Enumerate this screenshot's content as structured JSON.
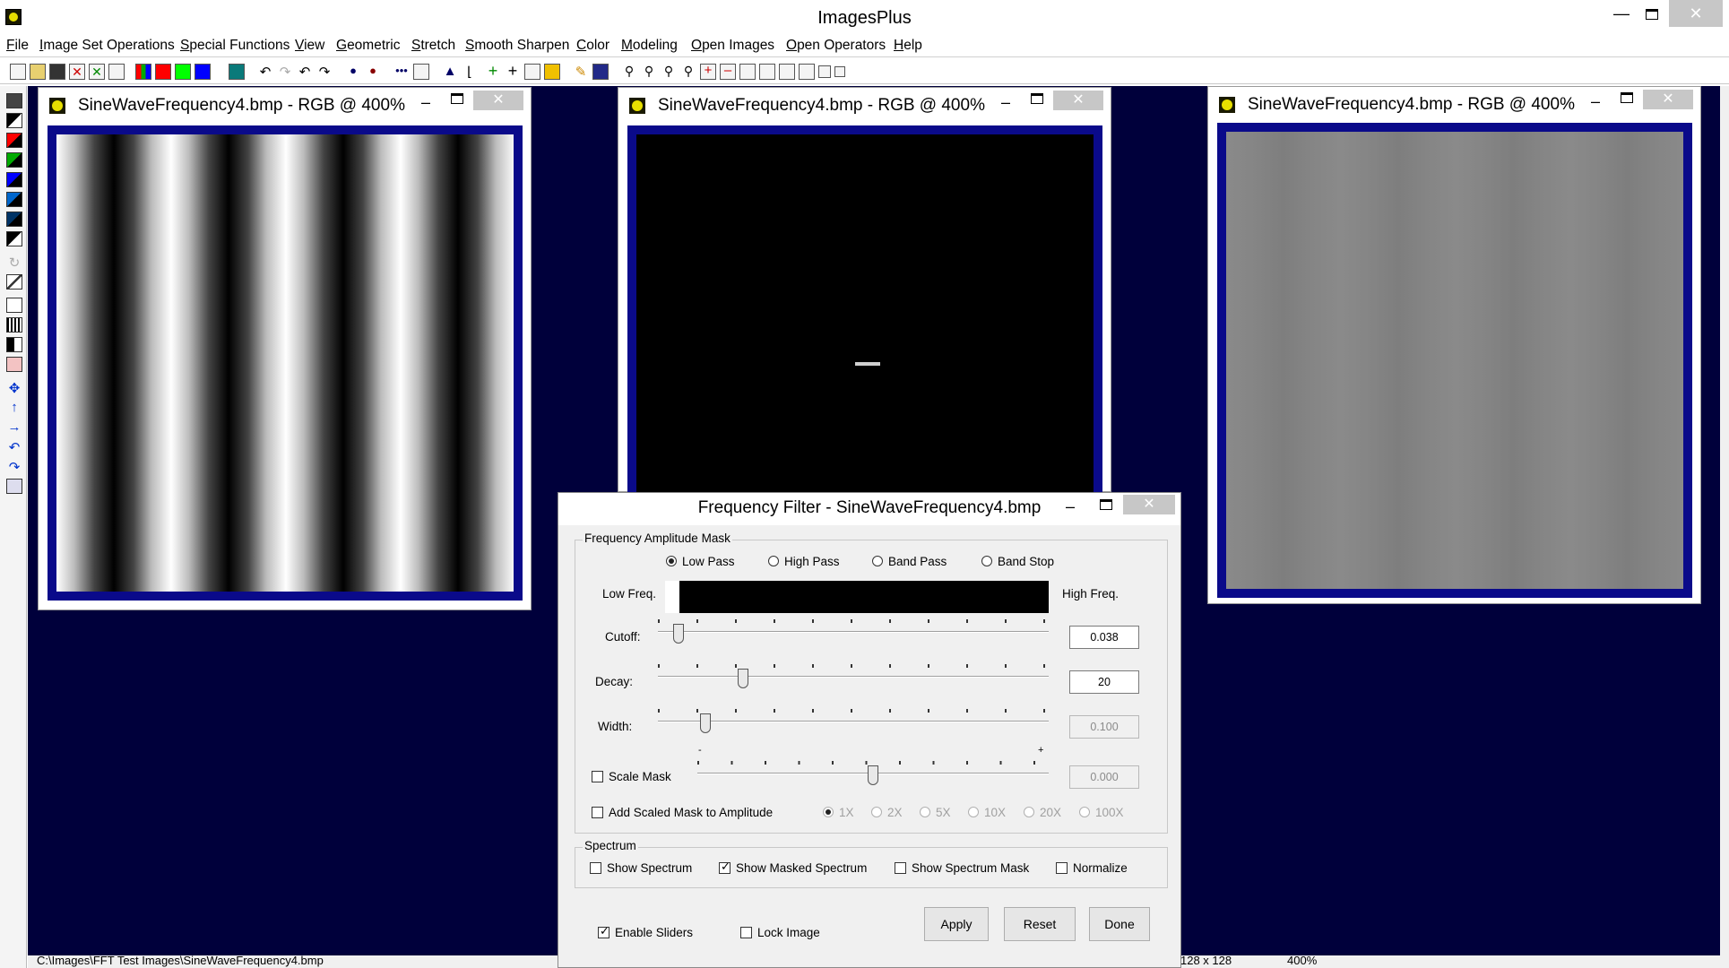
{
  "app": {
    "title": "ImagesPlus"
  },
  "menu": [
    "File",
    "Image Set Operations",
    "Special Functions",
    "View",
    "Geometric",
    "Stretch",
    "Smooth Sharpen",
    "Color",
    "Modeling",
    "Open Images",
    "Open Operators",
    "Help"
  ],
  "windows": [
    {
      "title": "SineWaveFrequency4.bmp - RGB @ 400%",
      "kind": "original-sine-wave"
    },
    {
      "title": "SineWaveFrequency4.bmp - RGB @ 400%",
      "kind": "masked-spectrum"
    },
    {
      "title": "SineWaveFrequency4.bmp - RGB @ 400%",
      "kind": "filtered-result"
    }
  ],
  "window_controls": {
    "close": "✕",
    "minimize": "–"
  },
  "dialog": {
    "title": "Frequency Filter - SineWaveFrequency4.bmp",
    "mask_group": {
      "label": "Frequency Amplitude Mask",
      "filter_types": [
        {
          "label": "Low Pass",
          "selected": true
        },
        {
          "label": "High Pass",
          "selected": false
        },
        {
          "label": "Band Pass",
          "selected": false
        },
        {
          "label": "Band Stop",
          "selected": false
        }
      ],
      "low_freq_label": "Low Freq.",
      "high_freq_label": "High Freq.",
      "cutoff": {
        "label": "Cutoff:",
        "value": "0.038",
        "level": 0.04
      },
      "decay": {
        "label": "Decay:",
        "value": "20",
        "level": 0.21
      },
      "width": {
        "label": "Width:",
        "value": "0.100",
        "level": 0.11
      },
      "scale_mask": {
        "label": "Scale Mask",
        "checked": false,
        "value": "0.000",
        "minus": "-",
        "plus": "+",
        "level": 0.5
      },
      "add_scaled": {
        "label": "Add Scaled Mask to Amplitude",
        "checked": false
      },
      "multipliers": [
        "1X",
        "2X",
        "5X",
        "10X",
        "20X",
        "100X"
      ]
    },
    "spectrum_group": {
      "label": "Spectrum",
      "show_spectrum": {
        "label": "Show Spectrum",
        "checked": false
      },
      "show_masked": {
        "label": "Show Masked Spectrum",
        "checked": true
      },
      "show_mask": {
        "label": "Show Spectrum Mask",
        "checked": false
      },
      "normalize": {
        "label": "Normalize",
        "checked": false
      }
    },
    "enable_sliders": {
      "label": "Enable Sliders",
      "checked": true
    },
    "lock_image": {
      "label": "Lock Image",
      "checked": false
    },
    "buttons": {
      "apply": "Apply",
      "reset": "Reset",
      "done": "Done"
    }
  },
  "status": {
    "path": "C:\\Images\\FFT Test Images\\SineWaveFrequency4.bmp",
    "size": "128 x 128",
    "zoom": "400%"
  },
  "colors": {
    "mdi_background": "#00003b",
    "image_frame": "#0a0a8a",
    "close_button": "#c7c7c7"
  }
}
